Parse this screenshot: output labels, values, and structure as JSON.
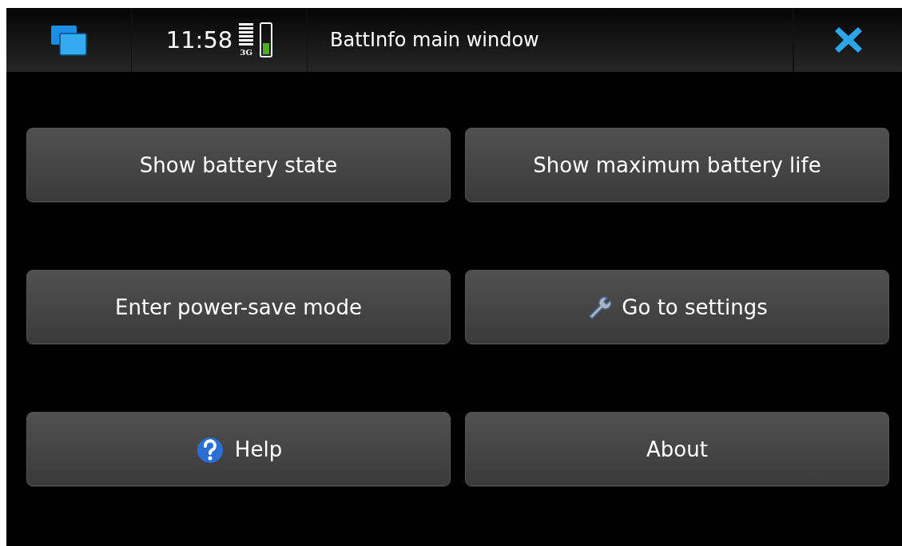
{
  "status_bar": {
    "time": "11:58",
    "network": "3G",
    "battery": {
      "level": 0.4
    }
  },
  "window": {
    "title": "BattInfo main window"
  },
  "buttons": [
    {
      "label": "Show battery state",
      "kind": "plain"
    },
    {
      "label": "Show maximum battery life",
      "kind": "plain"
    },
    {
      "label": "Enter power-save mode",
      "kind": "plain"
    },
    {
      "label": "Go to settings",
      "kind": "wrench"
    },
    {
      "label": "Help",
      "kind": "help"
    },
    {
      "label": "About",
      "kind": "plain"
    }
  ]
}
